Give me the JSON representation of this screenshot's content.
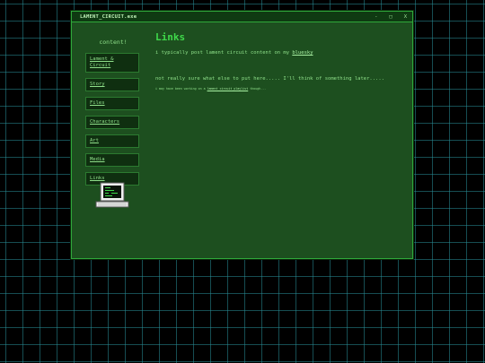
{
  "window": {
    "title": "LAMENT_CIRCUIT.exe",
    "controls": {
      "minimize": "-",
      "maximize": "□",
      "close": "X"
    }
  },
  "sidebar": {
    "title": "content!",
    "items": [
      {
        "label": "Lament & Circuit"
      },
      {
        "label": "Story"
      },
      {
        "label": "Files"
      },
      {
        "label": "Characters"
      },
      {
        "label": "Art"
      },
      {
        "label": "Media"
      },
      {
        "label": "Links"
      }
    ]
  },
  "main": {
    "title": "Links",
    "p1_text": "i typically post lament circuit content on my ",
    "p1_link": "bluesky",
    "p2_text": "not really sure what else to put here..... I'll think of something later.....",
    "p3_text": "i may have been working on a ",
    "p3_link": "lament circuit playlist",
    "p3_end": " though..."
  },
  "icon": "retro-computer-icon",
  "colors": {
    "window_bg": "#1d4f1f",
    "accent": "#3fd84a",
    "text": "#8fe08a",
    "grid": "#288c96"
  }
}
